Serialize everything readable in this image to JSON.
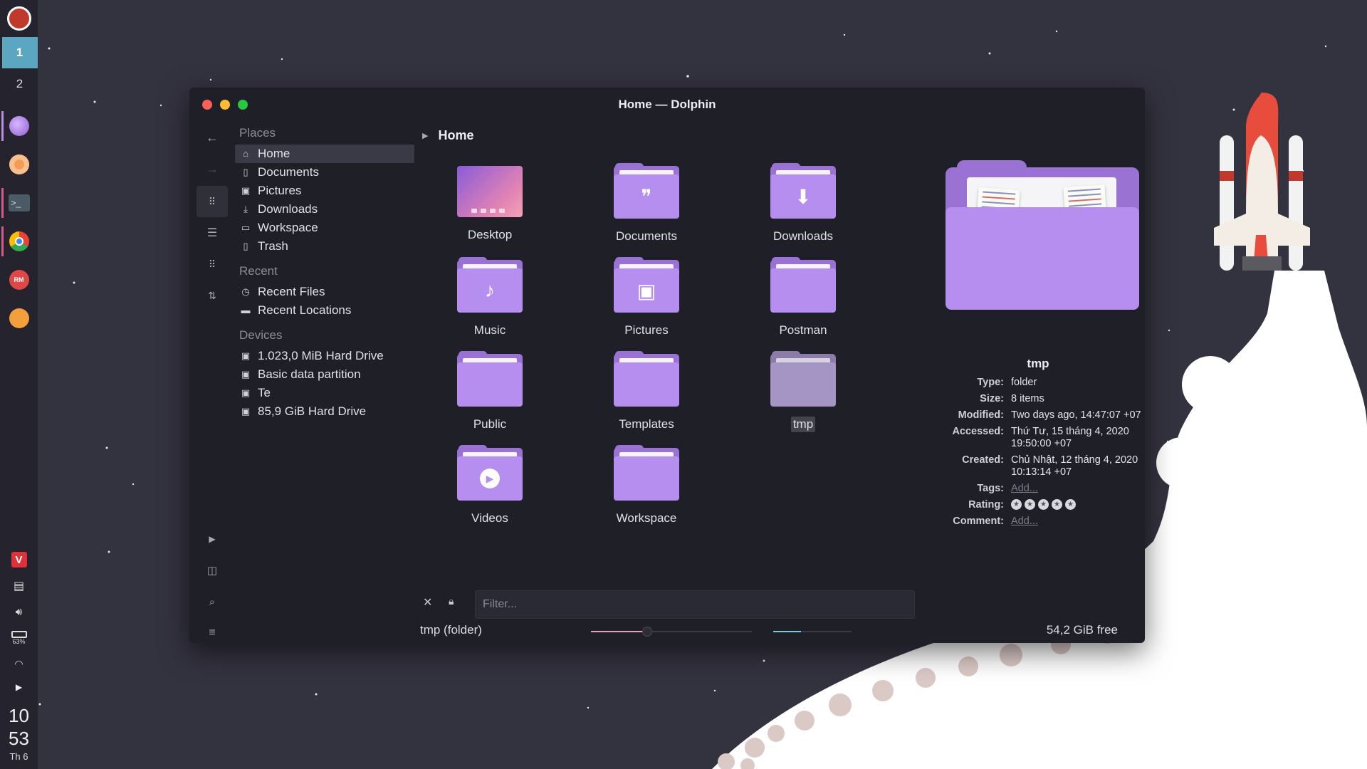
{
  "workspaces": [
    "1",
    "2"
  ],
  "dock_icons": [
    "firefox-nightly-icon",
    "ferdi-icon",
    "terminal-icon",
    "chrome-icon",
    "rm-icon",
    "thunderbird-icon"
  ],
  "tray": {
    "battery": "63%",
    "clock_hour": "10",
    "clock_minute": "53",
    "clock_day": "Th 6"
  },
  "window": {
    "title": "Home — Dolphin"
  },
  "places": {
    "places_header": "Places",
    "places_items": [
      {
        "label": "Home",
        "icon": "home-icon"
      },
      {
        "label": "Documents",
        "icon": "document-icon"
      },
      {
        "label": "Pictures",
        "icon": "picture-icon"
      },
      {
        "label": "Downloads",
        "icon": "download-icon"
      },
      {
        "label": "Workspace",
        "icon": "folder-icon"
      },
      {
        "label": "Trash",
        "icon": "trash-icon"
      }
    ],
    "recent_header": "Recent",
    "recent_items": [
      {
        "label": "Recent Files",
        "icon": "clock-icon"
      },
      {
        "label": "Recent Locations",
        "icon": "location-icon"
      }
    ],
    "devices_header": "Devices",
    "device_items": [
      {
        "label": "1.023,0 MiB Hard Drive",
        "icon": "drive-icon"
      },
      {
        "label": "Basic data partition",
        "icon": "drive-icon"
      },
      {
        "label": "Te",
        "icon": "drive-icon"
      },
      {
        "label": "85,9 GiB Hard Drive",
        "icon": "drive-icon"
      }
    ]
  },
  "breadcrumb": {
    "location": "Home"
  },
  "files": [
    {
      "label": "Desktop"
    },
    {
      "label": "Documents",
      "glyph": "❞"
    },
    {
      "label": "Downloads",
      "glyph": "⬇"
    },
    {
      "label": "Music",
      "glyph": "♪"
    },
    {
      "label": "Pictures",
      "glyph": "▣"
    },
    {
      "label": "Postman"
    },
    {
      "label": "Public"
    },
    {
      "label": "Templates"
    },
    {
      "label": "tmp"
    },
    {
      "label": "Videos",
      "glyph": "▶"
    },
    {
      "label": "Workspace"
    }
  ],
  "info": {
    "name": "tmp",
    "rows": [
      {
        "k": "Type:",
        "v": "folder"
      },
      {
        "k": "Size:",
        "v": "8 items"
      },
      {
        "k": "Modified:",
        "v": "Two days ago, 14:47:07 +07"
      },
      {
        "k": "Accessed:",
        "v": "Thứ Tư, 15 tháng 4, 2020 19:50:00 +07"
      },
      {
        "k": "Created:",
        "v": "Chủ Nhật, 12 tháng 4, 2020 10:13:14 +07"
      },
      {
        "k": "Tags:",
        "v": "Add..."
      },
      {
        "k": "Rating:",
        "v": ""
      },
      {
        "k": "Comment:",
        "v": "Add..."
      }
    ],
    "rating": 0
  },
  "filter": {
    "placeholder": "Filter..."
  },
  "status": {
    "selection": "tmp (folder)",
    "free_space": "54,2 GiB free",
    "zoom_fraction": 0.35,
    "used_fraction": 0.35
  },
  "colors": {
    "accent_folder": "#b68ef0",
    "workspace_active": "#5ba6c0",
    "close": "#ff5f57",
    "minimize": "#febc2e",
    "maximize": "#28c840"
  }
}
